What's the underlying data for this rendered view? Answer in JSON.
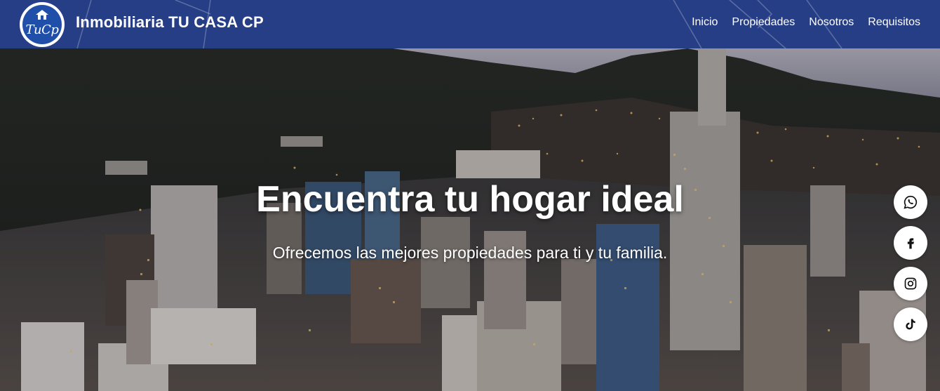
{
  "header": {
    "brand": "Inmobiliaria TU CASA CP",
    "logo_text": "TuCp",
    "background": "#263e86",
    "nav": [
      {
        "label": "Inicio"
      },
      {
        "label": "Propiedades"
      },
      {
        "label": "Nosotros"
      },
      {
        "label": "Requisitos"
      }
    ]
  },
  "hero": {
    "title": "Encuentra tu hogar ideal",
    "subtitle": "Ofrecemos las mejores propiedades para ti y tu familia."
  },
  "social": [
    {
      "name": "whatsapp-icon"
    },
    {
      "name": "facebook-icon"
    },
    {
      "name": "instagram-icon"
    },
    {
      "name": "tiktok-icon"
    }
  ]
}
